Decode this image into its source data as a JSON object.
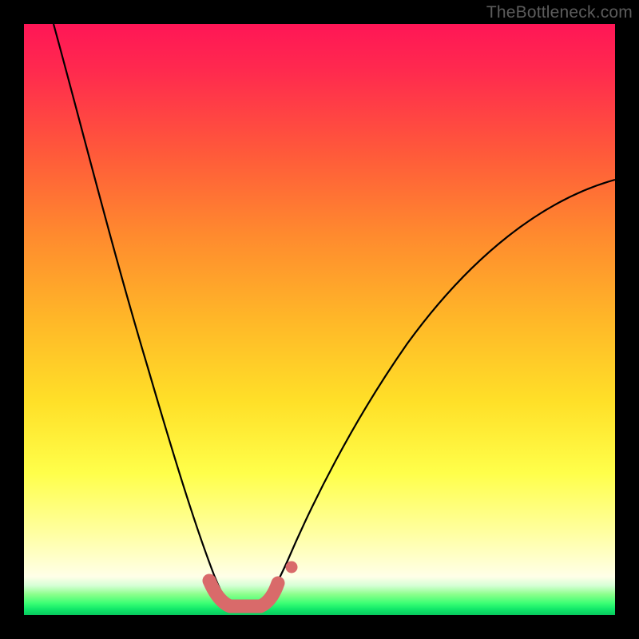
{
  "watermark": "TheBottleneck.com",
  "chart_data": {
    "type": "line",
    "title": "",
    "xlabel": "",
    "ylabel": "",
    "xlim": [
      0,
      100
    ],
    "ylim": [
      0,
      100
    ],
    "grid": false,
    "legend": false,
    "notes": "V-shaped bottleneck curve over a vertical heat gradient. Axes are unlabeled; x and y normalized 0–100. Left branch descends steeply from top-left toward the trough; right branch rises with a long concave tail toward top-right. Trough marked with coral-pink rounded segment and one detached dot.",
    "series": [
      {
        "name": "curve-left",
        "x": [
          5,
          8,
          11,
          14,
          17,
          20,
          23,
          26,
          28,
          30,
          31.5,
          33
        ],
        "y": [
          100,
          85,
          70,
          56,
          43,
          31,
          21,
          13,
          8,
          4.5,
          2.5,
          1.5
        ]
      },
      {
        "name": "curve-right",
        "x": [
          40,
          42,
          45,
          50,
          56,
          63,
          71,
          80,
          89,
          97,
          100
        ],
        "y": [
          1.5,
          3,
          7,
          15,
          25,
          36,
          47,
          57,
          65,
          71,
          73
        ]
      },
      {
        "name": "trough-marker",
        "style": "thick-coral",
        "x": [
          31,
          32.5,
          34,
          36,
          38,
          39.5,
          41
        ],
        "y": [
          5,
          2.5,
          1.2,
          1,
          1.2,
          2.5,
          5
        ]
      },
      {
        "name": "trough-dot",
        "style": "coral-dot",
        "x": [
          43.5
        ],
        "y": [
          8
        ]
      }
    ],
    "gradient_stops": [
      {
        "pos": 0.0,
        "color": "#ff1656"
      },
      {
        "pos": 0.22,
        "color": "#ff5a3a"
      },
      {
        "pos": 0.5,
        "color": "#ffb728"
      },
      {
        "pos": 0.76,
        "color": "#ffff4a"
      },
      {
        "pos": 0.94,
        "color": "#ffffe8"
      },
      {
        "pos": 0.97,
        "color": "#8cff8c"
      },
      {
        "pos": 1.0,
        "color": "#08c95e"
      }
    ]
  }
}
